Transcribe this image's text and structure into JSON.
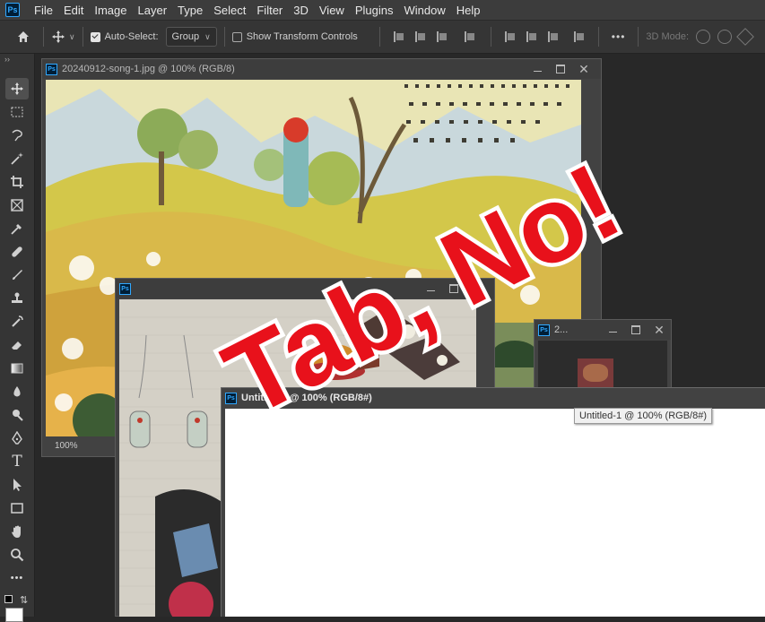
{
  "menubar": {
    "logo": "Ps",
    "items": [
      "File",
      "Edit",
      "Image",
      "Layer",
      "Type",
      "Select",
      "Filter",
      "3D",
      "View",
      "Plugins",
      "Window",
      "Help"
    ]
  },
  "options": {
    "auto_select_label": "Auto-Select:",
    "auto_select_checked": true,
    "group_value": "Group",
    "transform_label": "Show Transform Controls",
    "transform_checked": false,
    "more": "•••",
    "mode_label": "3D Mode:"
  },
  "toolbar": {
    "collapse": "››",
    "tools": [
      "move-tool",
      "marquee-tool",
      "lasso-tool",
      "magic-wand-tool",
      "crop-tool",
      "frame-tool",
      "eyedropper-tool",
      "healing-tool",
      "brush-tool",
      "stamp-tool",
      "history-brush-tool",
      "eraser-tool",
      "gradient-tool",
      "blur-tool",
      "dodge-tool",
      "pen-tool",
      "type-tool",
      "path-select-tool",
      "shape-tool",
      "hand-tool",
      "zoom-tool",
      "more-tools"
    ],
    "more": "•••"
  },
  "documents": [
    {
      "title": "20240912-song-1.jpg @ 100% (RGB/8)",
      "zoom": "100%"
    },
    {
      "title": "",
      "zoom": ""
    },
    {
      "title": "2...",
      "zoom": ""
    },
    {
      "title": "Untitled-1 @ 100% (RGB/8#)",
      "zoom": ""
    }
  ],
  "tooltip": "Untitled-1 @ 100% (RGB/8#)",
  "overlay": {
    "text": "Tab, No!",
    "fill": "#e8111b",
    "stroke": "#ffffff"
  },
  "colors": {
    "accent": "#31a8ff",
    "menubar": "#3c3c3c",
    "panel": "#353535",
    "workspace": "#282828"
  }
}
